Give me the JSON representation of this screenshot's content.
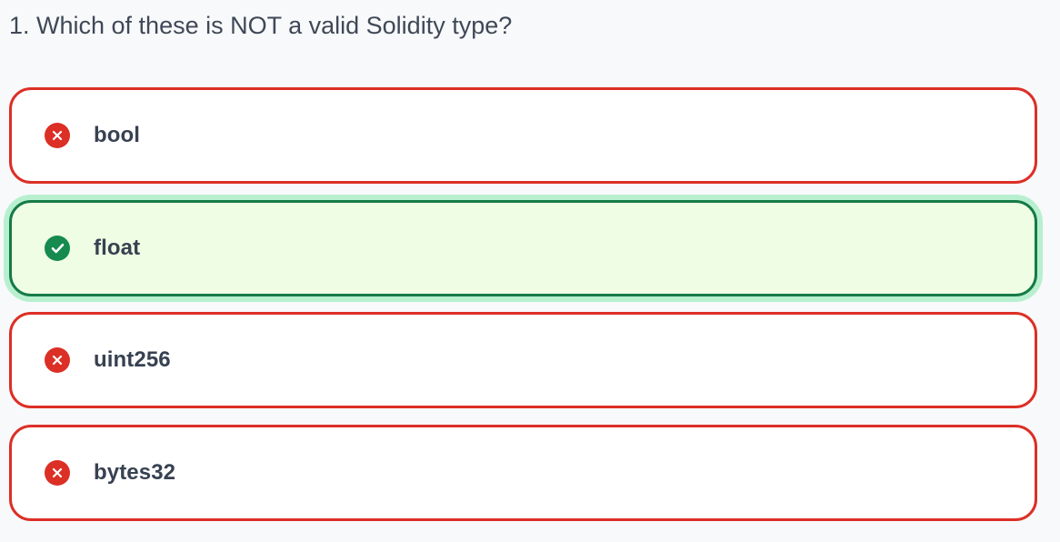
{
  "quiz": {
    "question": "1. Which of these is NOT a valid Solidity type?",
    "options": [
      {
        "label": "bool",
        "status": "incorrect",
        "icon": "x-circle-icon"
      },
      {
        "label": "float",
        "status": "correct",
        "icon": "check-circle-icon"
      },
      {
        "label": "uint256",
        "status": "incorrect",
        "icon": "x-circle-icon"
      },
      {
        "label": "bytes32",
        "status": "incorrect",
        "icon": "x-circle-icon"
      }
    ]
  },
  "colors": {
    "background": "#f8f9fb",
    "wrong_border": "#dc2f26",
    "correct_border": "#167a47",
    "correct_background": "#eefde3",
    "correct_glow": "#b8f0cf",
    "text": "#374151"
  }
}
